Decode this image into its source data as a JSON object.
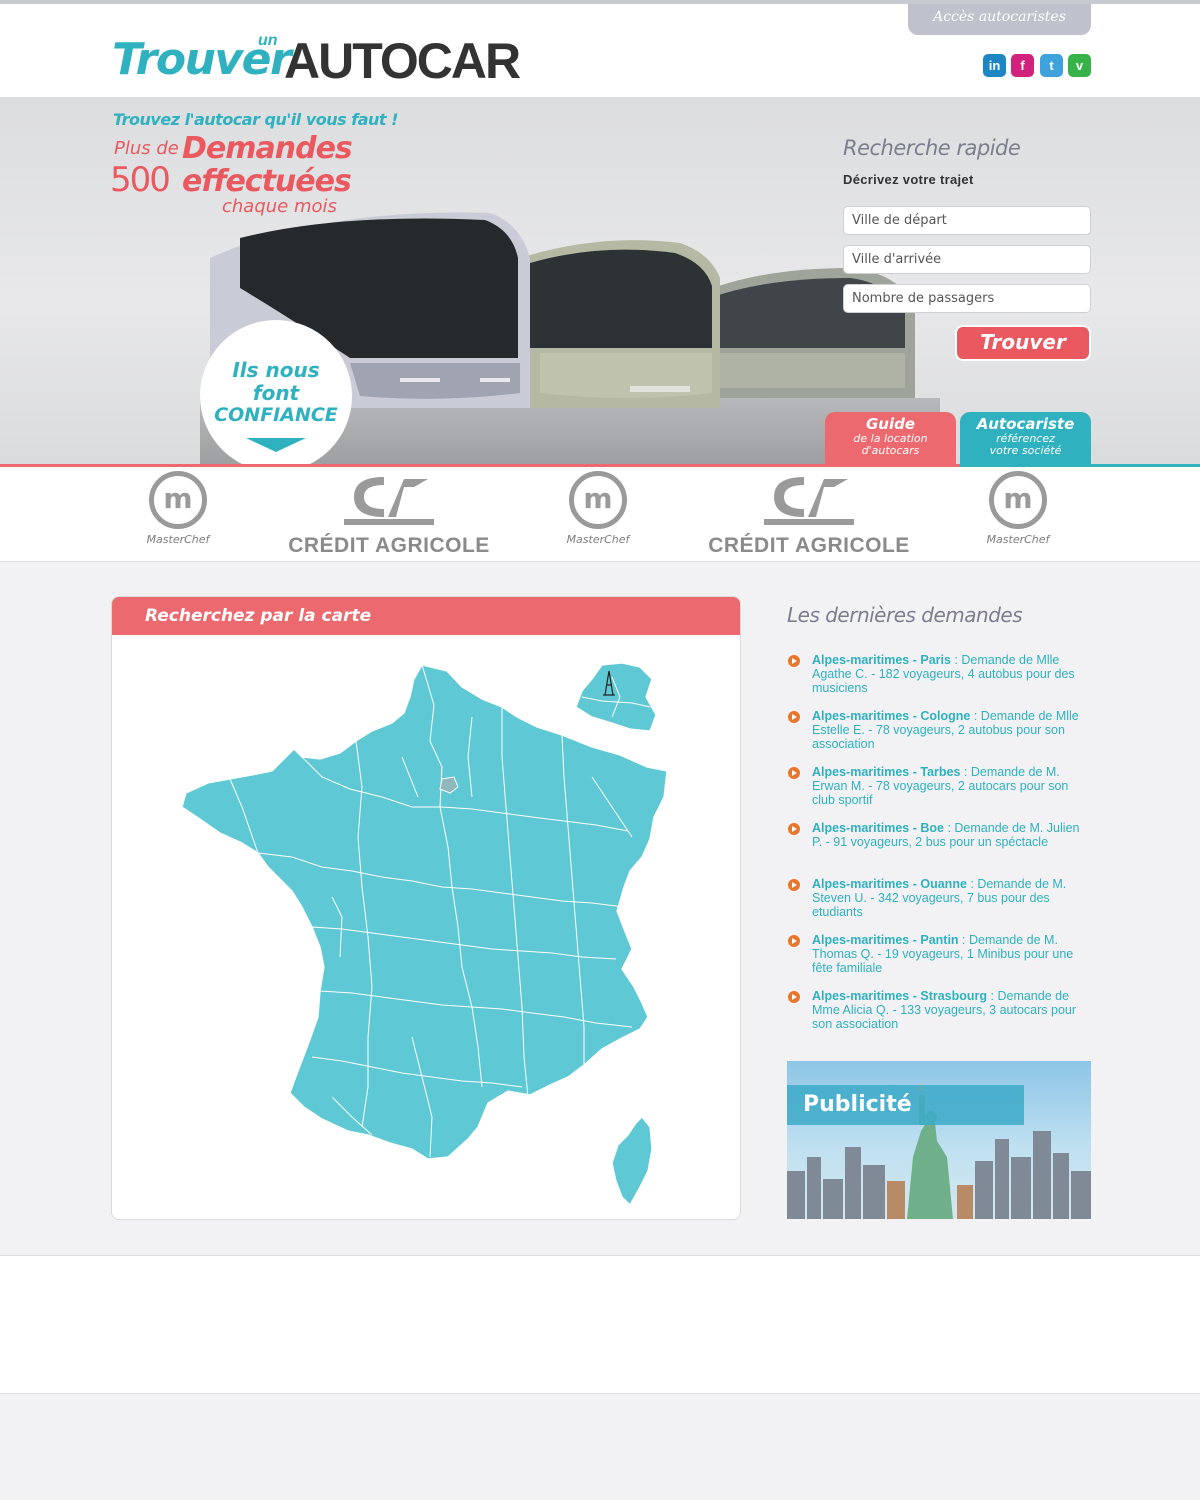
{
  "header": {
    "access_link": "Accès autocaristes",
    "logo": {
      "word1": "Trouver",
      "word2": "un",
      "word3": "AUTOCAR"
    },
    "social": [
      "in",
      "f",
      "t",
      "v"
    ]
  },
  "hero": {
    "tagline": "Trouvez l'autocar qu'il vous faut !",
    "plus_de": "Plus de",
    "number": "500",
    "demandes": "Demandes",
    "effectuees": "effectuées",
    "chaque_mois": "chaque mois",
    "badge": {
      "l1": "Ils nous",
      "l2": "font",
      "l3": "CONFIANCE"
    }
  },
  "quick_search": {
    "title": "Recherche rapide",
    "subtitle": "Décrivez votre trajet",
    "departure": "Ville de départ",
    "arrival": "Ville d'arrivée",
    "passengers": "Nombre de passagers",
    "button": "Trouver"
  },
  "tabs": {
    "guide": {
      "title": "Guide",
      "line1": "de la location",
      "line2": "d'autocars"
    },
    "autocariste": {
      "title": "Autocariste",
      "line1": "référencez",
      "line2": "votre société"
    }
  },
  "partners": {
    "masterchef": "MasterChef",
    "credit_agricole": "CRÉDIT AGRICOLE"
  },
  "map": {
    "title": "Recherchez par la carte"
  },
  "requests": {
    "title": "Les dernières demandes",
    "items": [
      {
        "place": "Alpes-maritimes - Paris",
        "text": " : Demande de Mlle Agathe C. - 182 voyageurs, 4 autobus pour des musiciens"
      },
      {
        "place": "Alpes-maritimes - Cologne",
        "text": " : Demande de Mlle Estelle E. - 78 voyageurs, 2 autobus pour son association"
      },
      {
        "place": "Alpes-maritimes - Tarbes",
        "text": " : Demande de M. Erwan M. - 78 voyageurs, 2 autocars pour son club sportif"
      },
      {
        "place": "Alpes-maritimes - Boe",
        "text": " : Demande de M. Julien P. - 91 voyageurs, 2 bus pour un spéctacle"
      },
      {
        "place": "Alpes-maritimes - Ouanne",
        "text": " : Demande de M. Steven U. - 342 voyageurs, 7 bus pour des etudiants"
      },
      {
        "place": "Alpes-maritimes - Pantin",
        "text": " : Demande de M. Thomas Q. - 19 voyageurs, 1 Minibus pour une fête familiale"
      },
      {
        "place": "Alpes-maritimes - Strasbourg",
        "text": " : Demande de Mme Alicia Q. - 133 voyageurs, 3 autocars pour son association"
      }
    ]
  },
  "ad": {
    "label": "Publicité"
  }
}
